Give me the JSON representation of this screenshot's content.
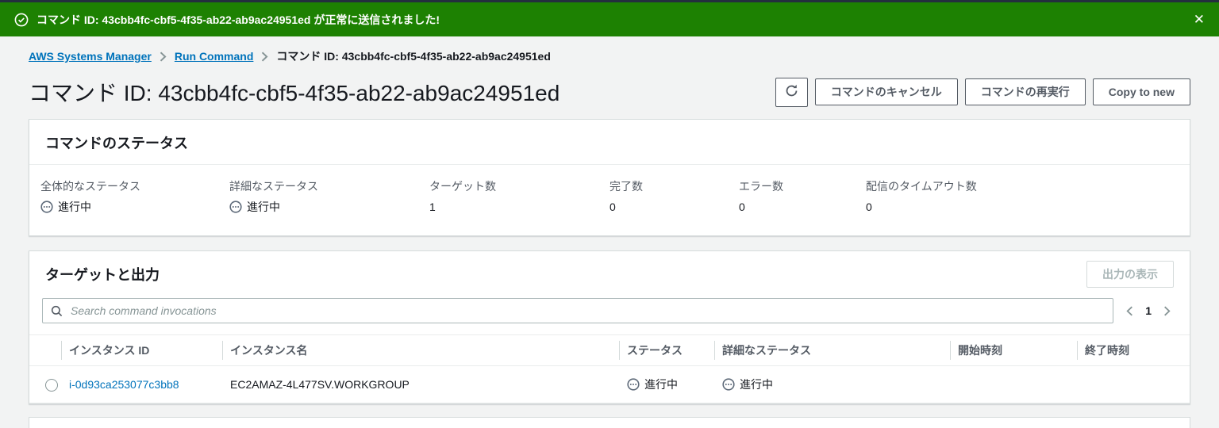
{
  "colors": {
    "banner_green": "#1d8102",
    "top_strip": "#232f3e",
    "link_blue": "#0073bb",
    "label_gray": "#545b64",
    "text_dark": "#16191f",
    "in_progress_icon": "#5f6b7a"
  },
  "banner": {
    "icon": "check-circle-icon",
    "message": "コマンド ID: 43cbb4fc-cbf5-4f35-ab22-ab9ac24951ed が正常に送信されました!",
    "close_glyph": "✕"
  },
  "breadcrumb": {
    "links": [
      "AWS Systems Manager",
      "Run Command"
    ],
    "current": "コマンド ID: 43cbb4fc-cbf5-4f35-ab22-ab9ac24951ed"
  },
  "page": {
    "title": "コマンド ID: 43cbb4fc-cbf5-4f35-ab22-ab9ac24951ed"
  },
  "toolbar": {
    "refresh_icon": "refresh-icon",
    "cancel_label": "コマンドのキャンセル",
    "rerun_label": "コマンドの再実行",
    "copy_label": "Copy to new"
  },
  "status_card": {
    "title": "コマンドのステータス",
    "fields": [
      {
        "label": "全体的なステータス",
        "value": "進行中",
        "icon": "in-progress-icon"
      },
      {
        "label": "詳細なステータス",
        "value": "進行中",
        "icon": "in-progress-icon"
      },
      {
        "label": "ターゲット数",
        "value": "1"
      },
      {
        "label": "完了数",
        "value": "0"
      },
      {
        "label": "エラー数",
        "value": "0"
      },
      {
        "label": "配信のタイムアウト数",
        "value": "0"
      }
    ]
  },
  "targets_card": {
    "title": "ターゲットと出力",
    "view_output_label": "出力の表示",
    "search": {
      "placeholder": "Search command invocations",
      "value": ""
    },
    "pagination": {
      "current_page": "1"
    },
    "table": {
      "headers": [
        "インスタンス ID",
        "インスタンス名",
        "ステータス",
        "詳細なステータス",
        "開始時刻",
        "終了時刻"
      ],
      "rows": [
        {
          "instance_id": "i-0d93ca253077c3bb8",
          "instance_name": "EC2AMAZ-4L477SV.WORKGROUP",
          "status": "進行中",
          "detailed_status": "進行中",
          "start_time": "",
          "end_time": ""
        }
      ]
    }
  }
}
